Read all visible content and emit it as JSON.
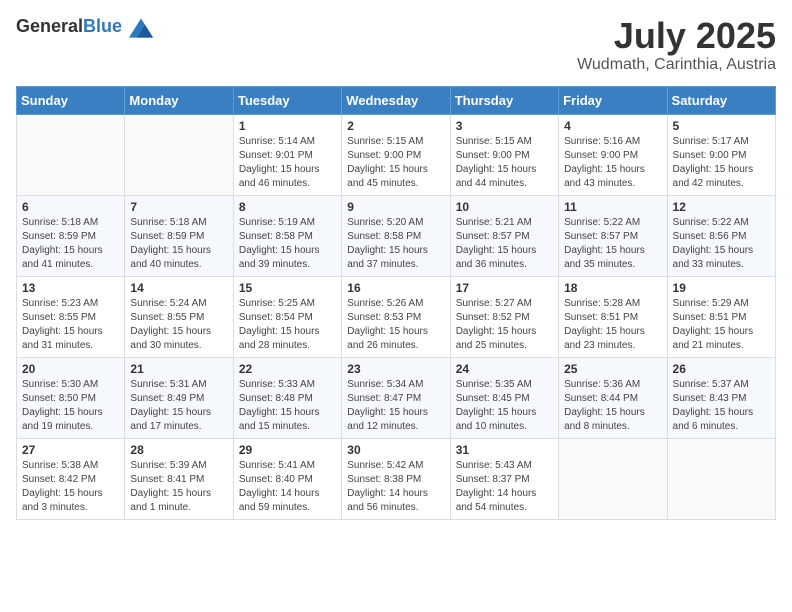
{
  "header": {
    "logo_general": "General",
    "logo_blue": "Blue",
    "month": "July 2025",
    "location": "Wudmath, Carinthia, Austria"
  },
  "weekdays": [
    "Sunday",
    "Monday",
    "Tuesday",
    "Wednesday",
    "Thursday",
    "Friday",
    "Saturday"
  ],
  "weeks": [
    [
      {
        "day": "",
        "info": ""
      },
      {
        "day": "",
        "info": ""
      },
      {
        "day": "1",
        "info": "Sunrise: 5:14 AM\nSunset: 9:01 PM\nDaylight: 15 hours and 46 minutes."
      },
      {
        "day": "2",
        "info": "Sunrise: 5:15 AM\nSunset: 9:00 PM\nDaylight: 15 hours and 45 minutes."
      },
      {
        "day": "3",
        "info": "Sunrise: 5:15 AM\nSunset: 9:00 PM\nDaylight: 15 hours and 44 minutes."
      },
      {
        "day": "4",
        "info": "Sunrise: 5:16 AM\nSunset: 9:00 PM\nDaylight: 15 hours and 43 minutes."
      },
      {
        "day": "5",
        "info": "Sunrise: 5:17 AM\nSunset: 9:00 PM\nDaylight: 15 hours and 42 minutes."
      }
    ],
    [
      {
        "day": "6",
        "info": "Sunrise: 5:18 AM\nSunset: 8:59 PM\nDaylight: 15 hours and 41 minutes."
      },
      {
        "day": "7",
        "info": "Sunrise: 5:18 AM\nSunset: 8:59 PM\nDaylight: 15 hours and 40 minutes."
      },
      {
        "day": "8",
        "info": "Sunrise: 5:19 AM\nSunset: 8:58 PM\nDaylight: 15 hours and 39 minutes."
      },
      {
        "day": "9",
        "info": "Sunrise: 5:20 AM\nSunset: 8:58 PM\nDaylight: 15 hours and 37 minutes."
      },
      {
        "day": "10",
        "info": "Sunrise: 5:21 AM\nSunset: 8:57 PM\nDaylight: 15 hours and 36 minutes."
      },
      {
        "day": "11",
        "info": "Sunrise: 5:22 AM\nSunset: 8:57 PM\nDaylight: 15 hours and 35 minutes."
      },
      {
        "day": "12",
        "info": "Sunrise: 5:22 AM\nSunset: 8:56 PM\nDaylight: 15 hours and 33 minutes."
      }
    ],
    [
      {
        "day": "13",
        "info": "Sunrise: 5:23 AM\nSunset: 8:55 PM\nDaylight: 15 hours and 31 minutes."
      },
      {
        "day": "14",
        "info": "Sunrise: 5:24 AM\nSunset: 8:55 PM\nDaylight: 15 hours and 30 minutes."
      },
      {
        "day": "15",
        "info": "Sunrise: 5:25 AM\nSunset: 8:54 PM\nDaylight: 15 hours and 28 minutes."
      },
      {
        "day": "16",
        "info": "Sunrise: 5:26 AM\nSunset: 8:53 PM\nDaylight: 15 hours and 26 minutes."
      },
      {
        "day": "17",
        "info": "Sunrise: 5:27 AM\nSunset: 8:52 PM\nDaylight: 15 hours and 25 minutes."
      },
      {
        "day": "18",
        "info": "Sunrise: 5:28 AM\nSunset: 8:51 PM\nDaylight: 15 hours and 23 minutes."
      },
      {
        "day": "19",
        "info": "Sunrise: 5:29 AM\nSunset: 8:51 PM\nDaylight: 15 hours and 21 minutes."
      }
    ],
    [
      {
        "day": "20",
        "info": "Sunrise: 5:30 AM\nSunset: 8:50 PM\nDaylight: 15 hours and 19 minutes."
      },
      {
        "day": "21",
        "info": "Sunrise: 5:31 AM\nSunset: 8:49 PM\nDaylight: 15 hours and 17 minutes."
      },
      {
        "day": "22",
        "info": "Sunrise: 5:33 AM\nSunset: 8:48 PM\nDaylight: 15 hours and 15 minutes."
      },
      {
        "day": "23",
        "info": "Sunrise: 5:34 AM\nSunset: 8:47 PM\nDaylight: 15 hours and 12 minutes."
      },
      {
        "day": "24",
        "info": "Sunrise: 5:35 AM\nSunset: 8:45 PM\nDaylight: 15 hours and 10 minutes."
      },
      {
        "day": "25",
        "info": "Sunrise: 5:36 AM\nSunset: 8:44 PM\nDaylight: 15 hours and 8 minutes."
      },
      {
        "day": "26",
        "info": "Sunrise: 5:37 AM\nSunset: 8:43 PM\nDaylight: 15 hours and 6 minutes."
      }
    ],
    [
      {
        "day": "27",
        "info": "Sunrise: 5:38 AM\nSunset: 8:42 PM\nDaylight: 15 hours and 3 minutes."
      },
      {
        "day": "28",
        "info": "Sunrise: 5:39 AM\nSunset: 8:41 PM\nDaylight: 15 hours and 1 minute."
      },
      {
        "day": "29",
        "info": "Sunrise: 5:41 AM\nSunset: 8:40 PM\nDaylight: 14 hours and 59 minutes."
      },
      {
        "day": "30",
        "info": "Sunrise: 5:42 AM\nSunset: 8:38 PM\nDaylight: 14 hours and 56 minutes."
      },
      {
        "day": "31",
        "info": "Sunrise: 5:43 AM\nSunset: 8:37 PM\nDaylight: 14 hours and 54 minutes."
      },
      {
        "day": "",
        "info": ""
      },
      {
        "day": "",
        "info": ""
      }
    ]
  ]
}
